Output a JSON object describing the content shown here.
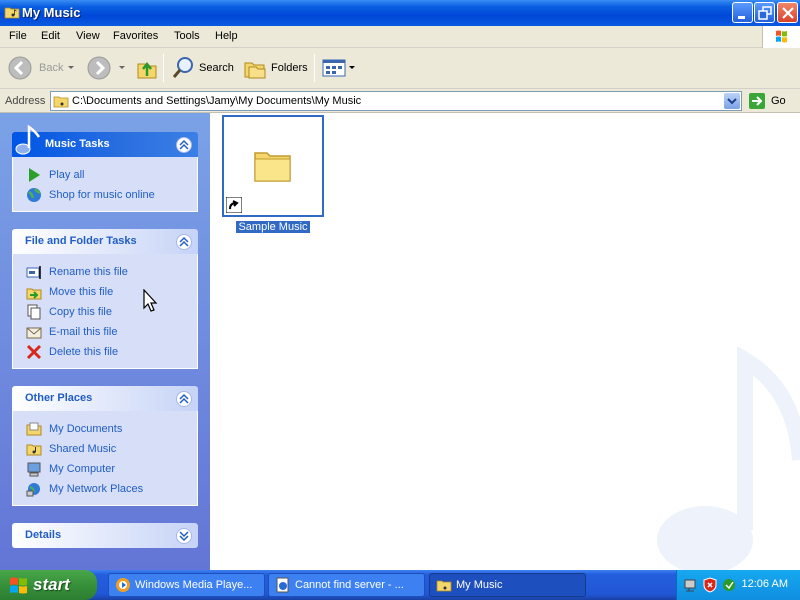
{
  "window": {
    "title": "My Music"
  },
  "menu": [
    "File",
    "Edit",
    "View",
    "Favorites",
    "Tools",
    "Help"
  ],
  "toolbar": {
    "back": "Back",
    "search": "Search",
    "folders": "Folders"
  },
  "address": {
    "label": "Address",
    "path": "C:\\Documents and Settings\\Jamy\\My Documents\\My Music",
    "go": "Go"
  },
  "panels": {
    "music_tasks": {
      "title": "Music Tasks",
      "items": [
        "Play all",
        "Shop for music online"
      ]
    },
    "file_tasks": {
      "title": "File and Folder Tasks",
      "items": [
        "Rename this file",
        "Move this file",
        "Copy this file",
        "E-mail this file",
        "Delete this file"
      ]
    },
    "other_places": {
      "title": "Other Places",
      "items": [
        "My Documents",
        "Shared Music",
        "My Computer",
        "My Network Places"
      ]
    },
    "details": {
      "title": "Details"
    }
  },
  "content": {
    "items": [
      {
        "label": "Sample Music"
      }
    ]
  },
  "taskbar": {
    "start": "start",
    "buttons": [
      "Windows Media Playe...",
      "Cannot find server - ...",
      "My Music"
    ],
    "clock": "12:06 AM"
  }
}
